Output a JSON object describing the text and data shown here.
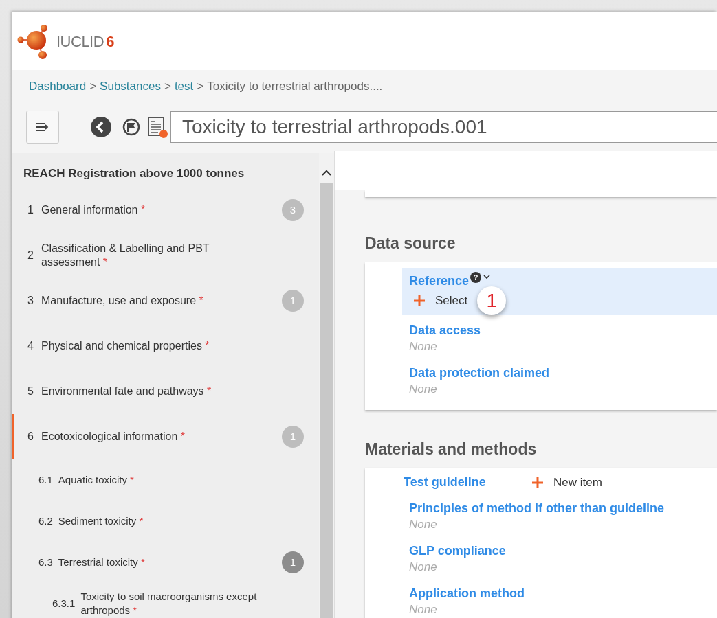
{
  "logo": {
    "name": "IUCLID",
    "version": "6"
  },
  "breadcrumb": [
    {
      "text": "Dashboard",
      "link": true
    },
    {
      "text": "Substances",
      "link": true
    },
    {
      "text": "test",
      "link": true
    },
    {
      "text": "Toxicity to terrestrial arthropods....",
      "link": false
    }
  ],
  "breadcrumb_separator": ">",
  "required_mark": "*",
  "document_title": "Toxicity to terrestrial arthropods.001",
  "sidebar": {
    "title": "REACH Registration above 1000 tonnes",
    "items": [
      {
        "number": "1",
        "label": "General information",
        "required": true,
        "badge": "3",
        "badge_dark": false,
        "selected": false
      },
      {
        "number": "2",
        "label": "Classification & Labelling and PBT assessment",
        "required": true,
        "selected": false
      },
      {
        "number": "3",
        "label": "Manufacture, use and exposure",
        "required": true,
        "badge": "1",
        "badge_dark": false,
        "selected": false
      },
      {
        "number": "4",
        "label": "Physical and chemical properties",
        "required": true,
        "selected": false
      },
      {
        "number": "5",
        "label": "Environmental fate and pathways",
        "required": true,
        "selected": false
      },
      {
        "number": "6",
        "label": "Ecotoxicological information",
        "required": true,
        "badge": "1",
        "badge_dark": false,
        "selected": true,
        "children": [
          {
            "number": "6.1",
            "label": "Aquatic toxicity",
            "required": true,
            "selected": false
          },
          {
            "number": "6.2",
            "label": "Sediment toxicity",
            "required": true,
            "selected": false
          },
          {
            "number": "6.3",
            "label": "Terrestrial toxicity",
            "required": true,
            "badge": "1",
            "badge_dark": true,
            "selected": false,
            "children": [
              {
                "number": "6.3.1",
                "label": "Toxicity to soil macroorganisms except arthropods",
                "required": true,
                "selected": false
              }
            ]
          }
        ]
      }
    ]
  },
  "sections": [
    {
      "title": "Data source",
      "fields": [
        {
          "kind": "reference",
          "label": "Reference",
          "selected": true,
          "help": "?",
          "action": "Select",
          "callout": "1"
        },
        {
          "kind": "value",
          "label": "Data access",
          "value": "None"
        },
        {
          "kind": "value",
          "label": "Data protection claimed",
          "value": "None"
        }
      ]
    },
    {
      "title": "Materials and methods",
      "fields": [
        {
          "kind": "repeatable",
          "label": "Test guideline",
          "action": "New item"
        },
        {
          "kind": "value",
          "label": "Principles of method if other than guideline",
          "value": "None"
        },
        {
          "kind": "value",
          "label": "GLP compliance",
          "value": "None"
        },
        {
          "kind": "value",
          "label": "Application method",
          "value": "None"
        }
      ]
    }
  ]
}
